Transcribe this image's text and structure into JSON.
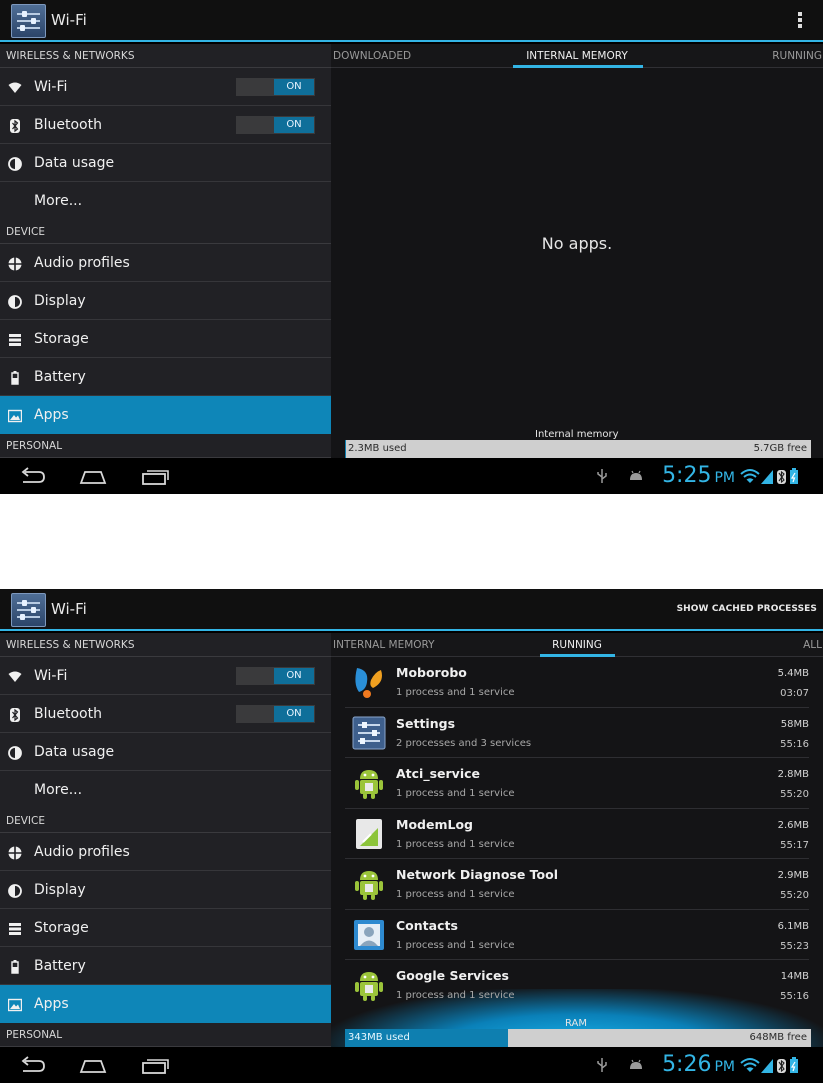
{
  "screens": [
    {
      "actionbar": {
        "title": "Wi-Fi",
        "action_label": ""
      },
      "left": {
        "sections": [
          {
            "header": "WIRELESS & NETWORKS",
            "items": [
              {
                "label": "Wi-Fi",
                "icon": "wifi-icon",
                "toggle": "ON"
              },
              {
                "label": "Bluetooth",
                "icon": "bluetooth-icon",
                "toggle": "ON"
              },
              {
                "label": "Data usage",
                "icon": "data-usage-icon"
              },
              {
                "label": "More...",
                "icon": ""
              }
            ]
          },
          {
            "header": "DEVICE",
            "items": [
              {
                "label": "Audio profiles",
                "icon": "audio-profiles-icon"
              },
              {
                "label": "Display",
                "icon": "display-icon"
              },
              {
                "label": "Storage",
                "icon": "storage-icon"
              },
              {
                "label": "Battery",
                "icon": "battery-icon"
              },
              {
                "label": "Apps",
                "icon": "apps-icon",
                "selected": true
              }
            ]
          },
          {
            "header": "PERSONAL",
            "items": []
          }
        ]
      },
      "right": {
        "tabs": [
          "DOWNLOADED",
          "INTERNAL MEMORY",
          "RUNNING"
        ],
        "active_tab": 1,
        "empty_message": "No apps.",
        "memory": {
          "label": "Internal memory",
          "used": "2.3MB used",
          "free": "5.7GB free",
          "used_fraction": 0.0004
        }
      },
      "navbar": {
        "time": "5:25",
        "ampm": "PM"
      }
    },
    {
      "actionbar": {
        "title": "Wi-Fi",
        "action_label": "SHOW CACHED PROCESSES"
      },
      "left": {
        "sections": [
          {
            "header": "WIRELESS & NETWORKS",
            "items": [
              {
                "label": "Wi-Fi",
                "icon": "wifi-icon",
                "toggle": "ON"
              },
              {
                "label": "Bluetooth",
                "icon": "bluetooth-icon",
                "toggle": "ON"
              },
              {
                "label": "Data usage",
                "icon": "data-usage-icon"
              },
              {
                "label": "More...",
                "icon": ""
              }
            ]
          },
          {
            "header": "DEVICE",
            "items": [
              {
                "label": "Audio profiles",
                "icon": "audio-profiles-icon"
              },
              {
                "label": "Display",
                "icon": "display-icon"
              },
              {
                "label": "Storage",
                "icon": "storage-icon"
              },
              {
                "label": "Battery",
                "icon": "battery-icon"
              },
              {
                "label": "Apps",
                "icon": "apps-icon",
                "selected": true
              }
            ]
          },
          {
            "header": "PERSONAL",
            "items": []
          }
        ]
      },
      "right": {
        "tabs": [
          "INTERNAL MEMORY",
          "RUNNING",
          "ALL"
        ],
        "active_tab": 1,
        "processes": [
          {
            "name": "Moborobo",
            "desc": "1 process and 1 service",
            "size": "5.4MB",
            "time": "03:07",
            "icon": "moborobo-icon"
          },
          {
            "name": "Settings",
            "desc": "2 processes and 3 services",
            "size": "58MB",
            "time": "55:16",
            "icon": "settings-app-icon"
          },
          {
            "name": "Atci_service",
            "desc": "1 process and 1 service",
            "size": "2.8MB",
            "time": "55:20",
            "icon": "android-icon"
          },
          {
            "name": "ModemLog",
            "desc": "1 process and 1 service",
            "size": "2.6MB",
            "time": "55:17",
            "icon": "modemlog-icon"
          },
          {
            "name": "Network Diagnose Tool",
            "desc": "1 process and 1 service",
            "size": "2.9MB",
            "time": "55:20",
            "icon": "android-icon"
          },
          {
            "name": "Contacts",
            "desc": "1 process and 1 service",
            "size": "6.1MB",
            "time": "55:23",
            "icon": "contacts-icon"
          },
          {
            "name": "Google Services",
            "desc": "1 process and 1 service",
            "size": "14MB",
            "time": "55:16",
            "icon": "android-icon"
          }
        ],
        "memory": {
          "label": "RAM",
          "used": "343MB used",
          "free": "648MB free",
          "used_fraction": 0.35
        }
      },
      "navbar": {
        "time": "5:26",
        "ampm": "PM"
      }
    }
  ],
  "colors": {
    "accent": "#33b5e5",
    "selected": "#0e86b8",
    "toggle_on": "#0f6f9a"
  }
}
